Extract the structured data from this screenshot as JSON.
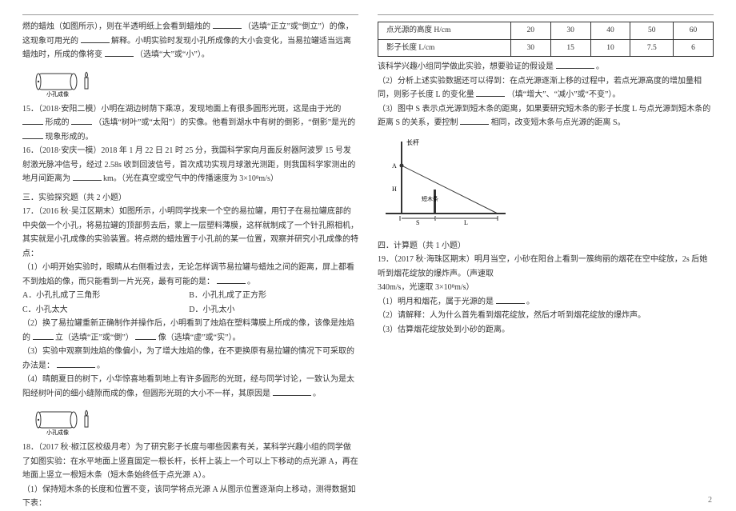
{
  "left": {
    "p1a": "燃的蜡烛（如图所示），则在半透明纸上会看到蜡烛的",
    "p1b": "（选填“正立”或“倒立”）的像，这现象可用光的",
    "p1c": "解释。小明实验时发现小孔所成像的大小会变化，当易拉罐适当远离蜡烛时，所成的像将变",
    "p1d": "（选填“大”或“小”）。",
    "img1_caption": "小孔成像",
    "q15a": "15．（2018·安阳二模）小明在湖边树荫下乘凉，发现地面上有很多圆形光斑，这是由于光的",
    "q15b": "形成的",
    "q15c": "（选填“树叶”或“太阳”）的实像。他看到湖水中有树的倒影，“倒影”是光的",
    "q15d": "现象形成的。",
    "q16a": "16．（2018·安庆一模）2018 年 1 月 22 日 21 时 25 分，我国科学家向月面反射器阿波罗 15 号发射激光脉冲信号，经过 2.58s 收到回波信号，首次成功实现月球激光测距，则我国科学家测出的地月间距离为",
    "q16b": "km。（光在真空或空气中的传播速度为 3×10⁸m/s）",
    "sec3": "三．实验探究题（共 2 小题）",
    "q17a": "17．（2016 秋·吴江区期末）如图所示，小明同学找来一个空的易拉罐，用钉子在易拉罐底部的中央做一个小孔，将易拉罐的顶部剪去后，蒙上一层塑料薄膜，这样就制成了一个针孔照相机，其实就是小孔成像的实验装置。将点燃的蜡烛置于小孔前的某一位置，观察并研究小孔成像的特点：",
    "q17_1a": "（1）小明开始实验时，眼睛从右侧看过去，无论怎样调节易拉罐与蜡烛之间的距离，屏上都看不到烛焰的像，而只能看到一片光亮，最有可能的是：",
    "q17_1b": "。",
    "q17_optA": "A．小孔扎成了三角形",
    "q17_optB": "B．小孔扎成了正方形",
    "q17_optC": "C．小孔太大",
    "q17_optD": "D．小孔太小",
    "q17_2a": "（2）换了易拉罐重新正确制作并操作后，小明看到了烛焰在塑料薄膜上所成的像，该像是烛焰的",
    "q17_2b": "立（选填“正”或“倒”）",
    "q17_2c": "像（选填“虚”或“实”）。",
    "q17_3a": "（3）实验中观察到烛焰的像偏小，为了增大烛焰的像，在不更换原有易拉罐的情况下可采取的办法是：",
    "q17_3b": "。",
    "q17_4a": "（4）晴朗夏日的树下，小华惊喜地看到地上有许多圆形的光斑，经与同学讨论，一致认为是太阳经树叶间的细小缝隙而成的像，但圆形光斑的大小不一样，其原因是",
    "q17_4b": "。",
    "img2_caption": "小孔成像",
    "q18a": "18．（2017 秋·椒江区校级月考）为了研究影子长度与哪些因素有关，某科学兴趣小组的同学做了如图实验：在水平地面上竖直固定一根长杆，长杆上装上一个可以上下移动的点光源 A，再在地面上竖立一根短木条（短木条始终低于点光源 A）。",
    "q18_1": "（1）保持短木条的长度和位置不变，该同学将点光源 A 从图示位置逐渐向上移动，测得数据如下表："
  },
  "right": {
    "tbl_h1": "点光源的高度 H/cm",
    "tbl_h2": "影子长度 L/cm",
    "tbl_cols": [
      "20",
      "30",
      "40",
      "50",
      "60"
    ],
    "tbl_vals": [
      "30",
      "15",
      "10",
      "7.5",
      "6"
    ],
    "r1a": "该科学兴趣小组同学做此实验，想要验证的假设是",
    "r1b": "。",
    "r2a": "（2）分析上述实验数据还可以得到：在点光源逐渐上移的过程中，若点光源高度的增加量相同，则影子长度 L 的变化量",
    "r2b": "（填“增大”、“减小”或“不变”）。",
    "r3a": "（3）图中 S 表示点光源到短木条的距离，如果要研究短木条的影子长度 L 与点光源到短木条的距离 S 的关系，要控制",
    "r3b": "相同，改变短木条与点光源的距离 S。",
    "chart_labels": {
      "y_top": "长杆",
      "A": "A",
      "H": "H",
      "stick": "短木条",
      "S": "S",
      "L": "L"
    },
    "sec4": "四．计算题（共 1 小题）",
    "q19a": "19．（2017 秋·海珠区期末）明月当空，小砂在阳台上看到一簇绚丽的烟花在空中绽放，2s 后她听到烟花绽放的爆炸声。（声速取",
    "q19b": "340m/s，光速取 3×10⁸m/s）",
    "q19_1": "（1）明月和烟花，属于光源的是",
    "q19_1b": "。",
    "q19_2": "（2）请解释：人为什么首先看到烟花绽放，然后才听到烟花绽放的爆炸声。",
    "q19_3": "（3）估算烟花绽放处到小砂的距离。",
    "page_num": "2"
  }
}
